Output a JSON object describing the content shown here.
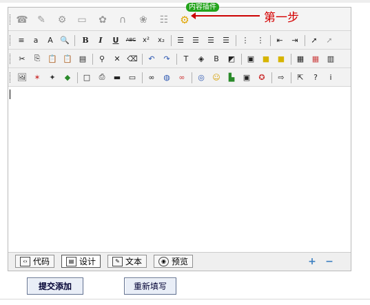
{
  "plugin_badge": "内容插件",
  "step_label": "第一步",
  "row1_icons": [
    "phone-icon",
    "paint-icon",
    "gear-icon",
    "window-icon",
    "flower-icon",
    "headset-icon",
    "butterfly-icon",
    "list-icon",
    "content-plugin-gear-icon"
  ],
  "formatting": {
    "bold": "B",
    "italic": "I",
    "underline": "U",
    "strike": "ABC",
    "superscript": "x²",
    "subscript": "x₂"
  },
  "modes": [
    {
      "label": "代码",
      "icon": "code-icon"
    },
    {
      "label": "设计",
      "icon": "design-icon",
      "active": true
    },
    {
      "label": "文本",
      "icon": "text-icon"
    },
    {
      "label": "预览",
      "icon": "preview-icon"
    }
  ],
  "zoom": {
    "in": "+",
    "out": "−"
  },
  "buttons": {
    "submit": "提交添加",
    "reset": "重新填写"
  },
  "colors": {
    "badge": "#23a41b",
    "annotation": "#cc0000"
  }
}
